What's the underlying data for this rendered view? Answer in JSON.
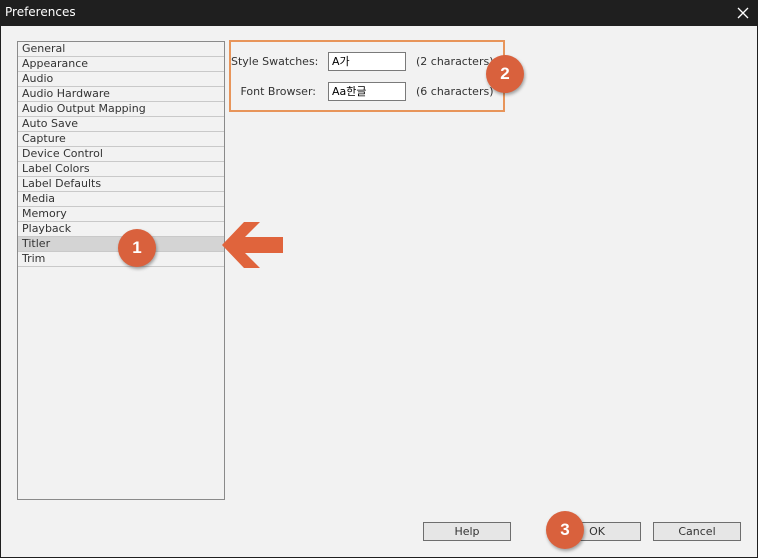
{
  "window": {
    "title": "Preferences"
  },
  "categories": [
    "General",
    "Appearance",
    "Audio",
    "Audio Hardware",
    "Audio Output Mapping",
    "Auto Save",
    "Capture",
    "Device Control",
    "Label Colors",
    "Label Defaults",
    "Media",
    "Memory",
    "Playback",
    "Titler",
    "Trim"
  ],
  "selected_category": "Titler",
  "titler": {
    "style_swatches": {
      "label": "Style Swatches:",
      "value": "A가",
      "note": "(2 characters)"
    },
    "font_browser": {
      "label": "Font Browser:",
      "value": "Aa한글",
      "note": "(6 characters)"
    }
  },
  "buttons": {
    "help": "Help",
    "ok": "OK",
    "cancel": "Cancel"
  },
  "annotations": {
    "step1": "1",
    "step2": "2",
    "step3": "3"
  },
  "colors": {
    "annotation_badge": "#d9613d",
    "annotation_arrow": "#e0643c",
    "highlight_border": "#e8955a",
    "selected_row": "#d4d4d4"
  },
  "icons": {
    "close": "close-icon",
    "arrow": "left-arrow-icon"
  }
}
